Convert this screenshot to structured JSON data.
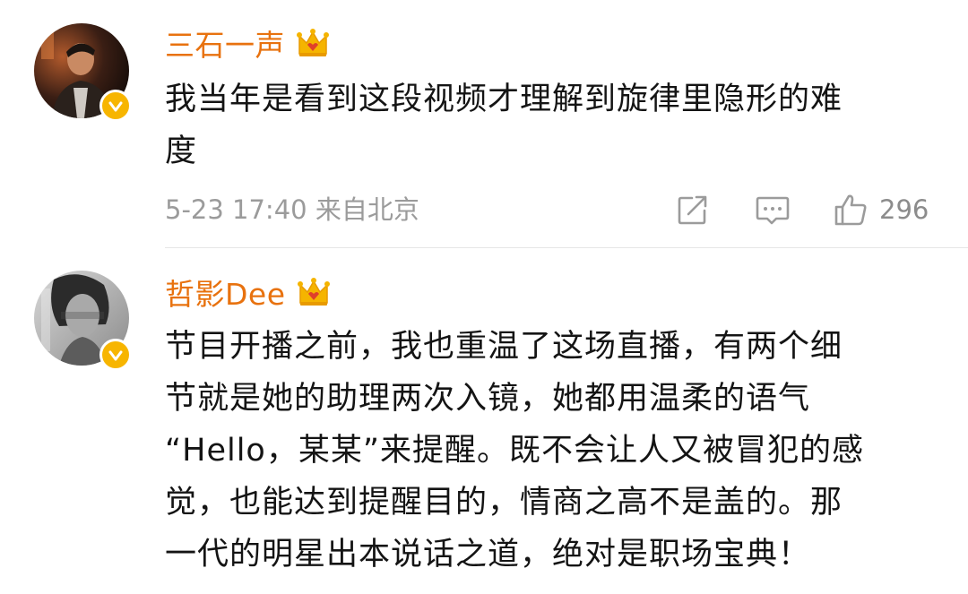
{
  "comments": [
    {
      "username": "三石一声",
      "avatar_icon": "avatar-man-portrait",
      "badge_icon": "crown-vip-icon",
      "verified_icon": "verified-badge-icon",
      "text": "我当年是看到这段视频才理解到旋律里隐形的难\n度",
      "timestamp": "5-23 17:40 来自北京",
      "actions": {
        "share_icon": "share-icon",
        "comment_icon": "comment-icon",
        "like_icon": "thumbs-up-icon",
        "like_count": "296"
      }
    },
    {
      "username": "哲影Dee",
      "avatar_icon": "avatar-bw-portrait",
      "badge_icon": "crown-vip-icon",
      "verified_icon": "verified-badge-icon",
      "text": "节目开播之前，我也重温了这场直播，有两个细\n节就是她的助理两次入镜，她都用温柔的语气\n“Hello，某某”来提醒。既不会让人又被冒犯的感\n觉，也能达到提醒目的，情商之高不是盖的。那\n一代的明星出本说话之道，绝对是职场宝典！"
    }
  ],
  "colors": {
    "username": "#e8720f",
    "crown": "#f0a400",
    "verified": "#f7b500",
    "meta": "#9b9b9b"
  }
}
